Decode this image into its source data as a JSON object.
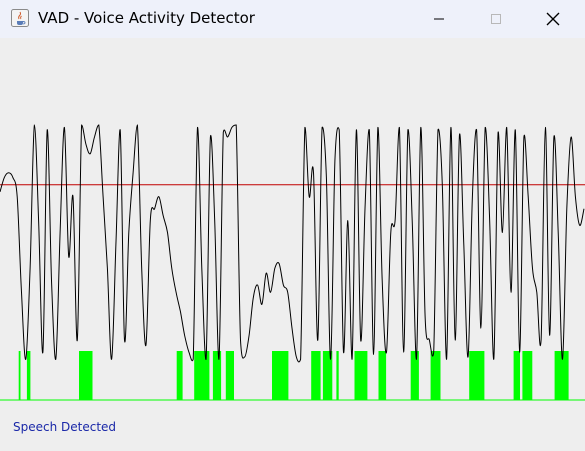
{
  "window": {
    "title": "VAD - Voice Activity Detector"
  },
  "status": {
    "text": "Speech Detected"
  },
  "colors": {
    "waveform": "#000000",
    "threshold": "#c00000",
    "speech_bar": "#00ff00",
    "status_text": "#1a28a8",
    "background": "#eeeeee"
  },
  "chart_data": {
    "type": "line",
    "description_series": "waveform energy trace with threshold and speech-detection bars",
    "ylim": [
      0,
      1
    ],
    "threshold": 0.75,
    "series": [
      {
        "values": [
          0.72,
          0.78,
          0.8,
          0.78,
          0.7,
          0.3,
          0.02,
          0.4,
          1.0,
          0.6,
          0.05,
          0.98,
          0.35,
          0.02,
          0.55,
          0.99,
          0.45,
          0.7,
          0.1,
          1.0,
          0.92,
          0.88,
          0.95,
          1.0,
          0.7,
          0.4,
          0.02,
          0.5,
          0.98,
          0.1,
          0.55,
          0.8,
          1.0,
          0.4,
          0.08,
          0.6,
          0.65,
          0.7,
          0.62,
          0.55,
          0.4,
          0.3,
          0.22,
          0.12,
          0.05,
          0.02,
          0.99,
          0.4,
          0.02,
          0.95,
          0.6,
          0.02,
          0.97,
          0.95,
          0.99,
          1.0,
          0.1,
          0.03,
          0.12,
          0.28,
          0.33,
          0.25,
          0.38,
          0.3,
          0.4,
          0.42,
          0.33,
          0.3,
          0.15,
          0.03,
          0.02,
          0.99,
          0.7,
          0.8,
          0.1,
          0.99,
          0.78,
          0.02,
          0.85,
          0.98,
          0.05,
          0.6,
          0.02,
          0.98,
          0.1,
          0.65,
          0.98,
          0.04,
          0.99,
          0.35,
          0.05,
          0.55,
          0.6,
          0.99,
          0.05,
          0.98,
          0.6,
          0.02,
          0.99,
          0.2,
          0.1,
          0.05,
          0.98,
          0.75,
          0.02,
          0.99,
          0.1,
          0.96,
          0.5,
          0.03,
          0.7,
          0.98,
          0.15,
          0.99,
          0.62,
          0.02,
          0.97,
          0.55,
          0.99,
          0.3,
          0.98,
          0.05,
          0.95,
          0.7,
          0.4,
          0.3,
          0.1,
          0.99,
          0.12,
          0.95,
          0.55,
          0.02,
          0.65,
          0.95,
          0.7,
          0.58,
          0.65
        ]
      }
    ],
    "speech_segments": [
      [
        0.032,
        0.035
      ],
      [
        0.046,
        0.052
      ],
      [
        0.135,
        0.158
      ],
      [
        0.302,
        0.312
      ],
      [
        0.332,
        0.358
      ],
      [
        0.364,
        0.378
      ],
      [
        0.386,
        0.4
      ],
      [
        0.465,
        0.493
      ],
      [
        0.532,
        0.548
      ],
      [
        0.552,
        0.568
      ],
      [
        0.575,
        0.579
      ],
      [
        0.606,
        0.628
      ],
      [
        0.647,
        0.66
      ],
      [
        0.702,
        0.716
      ],
      [
        0.736,
        0.753
      ],
      [
        0.802,
        0.828
      ],
      [
        0.878,
        0.889
      ],
      [
        0.893,
        0.91
      ],
      [
        0.948,
        0.972
      ]
    ]
  }
}
